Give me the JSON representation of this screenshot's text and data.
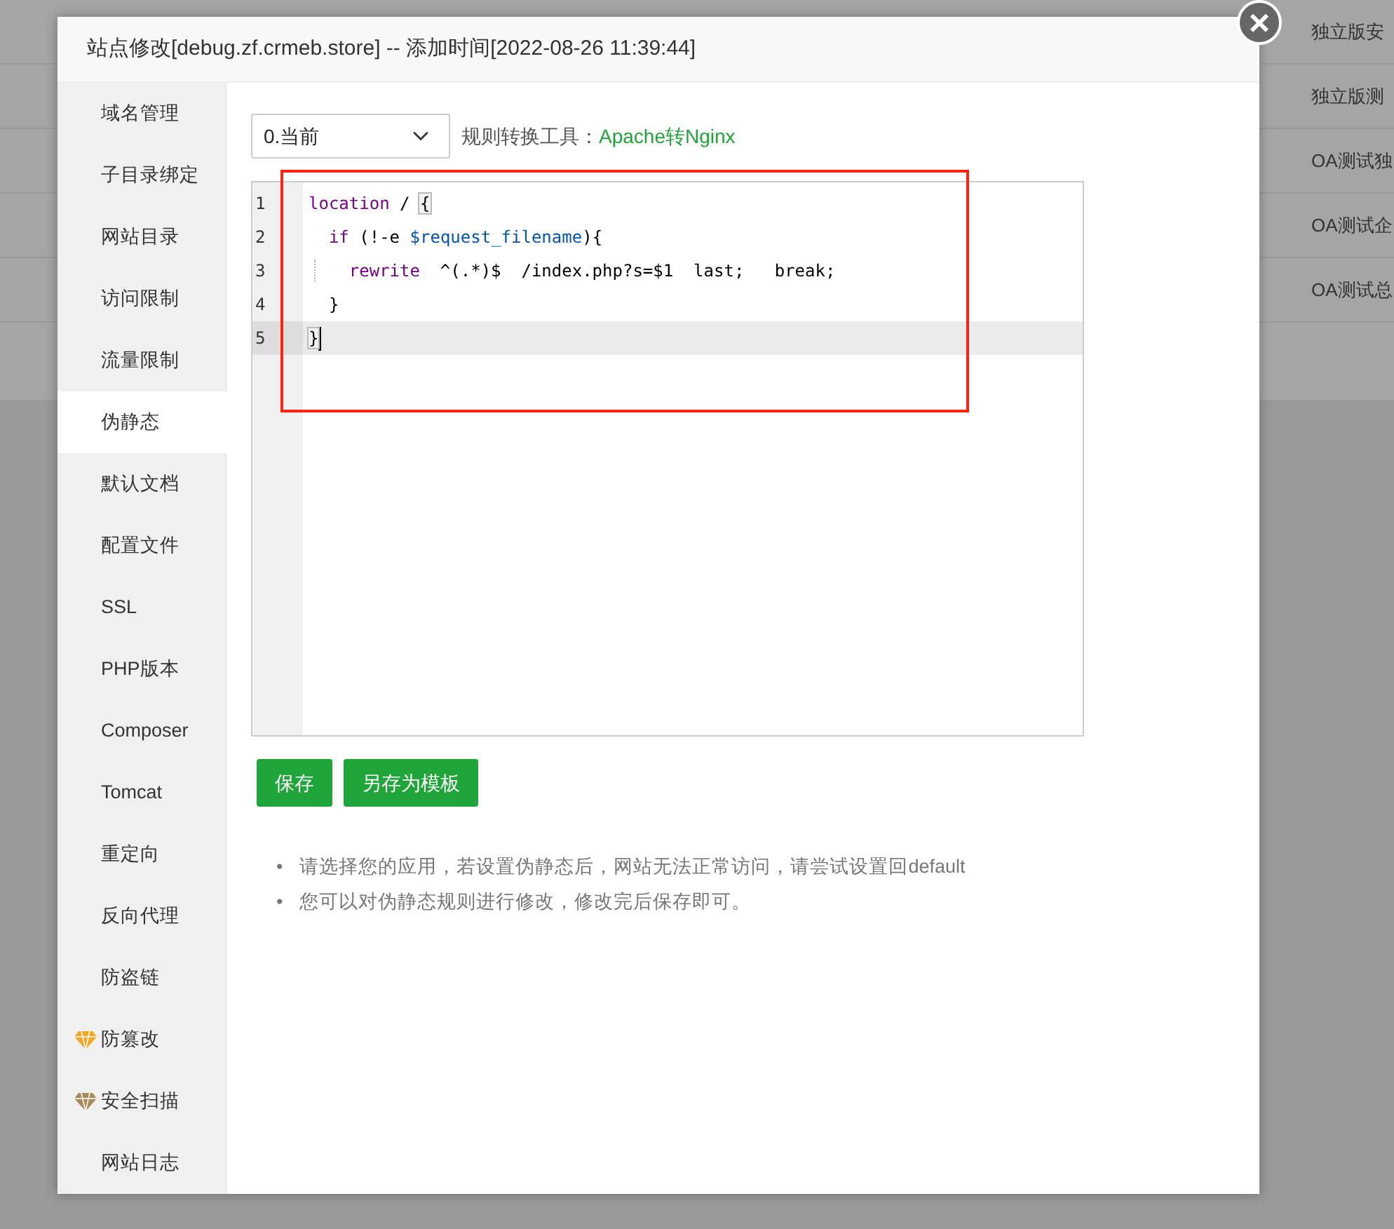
{
  "background_rows": [
    {
      "text": "独立版安"
    },
    {
      "text": "独立版测"
    },
    {
      "text": "OA测试独"
    },
    {
      "text": "OA测试企"
    },
    {
      "text": "OA测试总"
    }
  ],
  "dialog": {
    "title": "站点修改[debug.zf.crmeb.store] -- 添加时间[2022-08-26 11:39:44]",
    "close": "×"
  },
  "sidebar": {
    "items": [
      {
        "label": "域名管理",
        "selected": false
      },
      {
        "label": "子目录绑定",
        "selected": false
      },
      {
        "label": "网站目录",
        "selected": false
      },
      {
        "label": "访问限制",
        "selected": false
      },
      {
        "label": "流量限制",
        "selected": false
      },
      {
        "label": "伪静态",
        "selected": true
      },
      {
        "label": "默认文档",
        "selected": false
      },
      {
        "label": "配置文件",
        "selected": false
      },
      {
        "label": "SSL",
        "selected": false
      },
      {
        "label": "PHP版本",
        "selected": false
      },
      {
        "label": "Composer",
        "selected": false
      },
      {
        "label": "Tomcat",
        "selected": false
      },
      {
        "label": "重定向",
        "selected": false
      },
      {
        "label": "反向代理",
        "selected": false
      },
      {
        "label": "防盗链",
        "selected": false
      },
      {
        "label": "防篡改",
        "selected": false,
        "color": "#f5a623"
      },
      {
        "label": "安全扫描",
        "selected": false,
        "color": "#a88b5a"
      },
      {
        "label": "网站日志",
        "selected": false
      }
    ]
  },
  "rule_select": {
    "value": "0.当前"
  },
  "converter": {
    "label": "规则转换工具：",
    "link": "Apache转Nginx"
  },
  "editor": {
    "lines": [
      {
        "number": "1",
        "active": false,
        "tokens": [
          {
            "kind": "keyword",
            "text": "location"
          },
          {
            "kind": "plain",
            "text": " / "
          },
          {
            "kind": "bracket",
            "text": "{"
          }
        ]
      },
      {
        "number": "2",
        "active": false,
        "tokens": [
          {
            "kind": "keyword",
            "text": "  if"
          },
          {
            "kind": "plain",
            "text": " (!-e "
          },
          {
            "kind": "variable",
            "text": "$request_filename"
          },
          {
            "kind": "plain",
            "text": "){"
          }
        ]
      },
      {
        "number": "3",
        "active": false,
        "indent_guide": true,
        "tokens": [
          {
            "kind": "keyword",
            "text": "    rewrite"
          },
          {
            "kind": "plain",
            "text": "  ^(.*)$  /index.php?s=$1  last;   break;"
          }
        ]
      },
      {
        "number": "4",
        "active": false,
        "tokens": [
          {
            "kind": "plain",
            "text": "  }"
          }
        ]
      },
      {
        "number": "5",
        "active": true,
        "tokens": [
          {
            "kind": "bracket",
            "text": "}"
          }
        ]
      }
    ]
  },
  "buttons": [
    {
      "label": "保存"
    },
    {
      "label": "另存为模板"
    }
  ],
  "notes": [
    {
      "bullet": "•",
      "text": "请选择您的应用，若设置伪静态后，网站无法正常访问，请尝试设置回default"
    },
    {
      "bullet": "•",
      "text": "您可以对伪静态规则进行修改，修改完后保存即可。"
    }
  ]
}
